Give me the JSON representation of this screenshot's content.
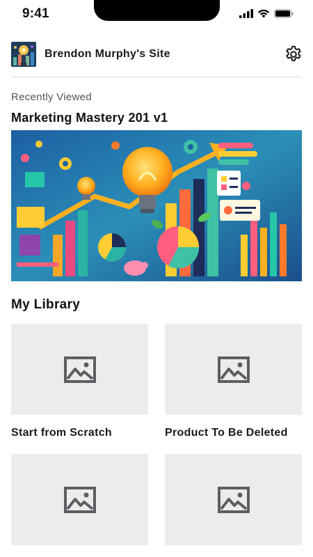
{
  "status": {
    "time": "9:41"
  },
  "header": {
    "site_title": "Brendon Murphy's Site"
  },
  "recent": {
    "label": "Recently Viewed",
    "course_title": "Marketing Mastery 201 v1"
  },
  "library": {
    "title": "My Library",
    "items": [
      {
        "label": "Start from Scratch"
      },
      {
        "label": "Product To Be Deleted"
      },
      {
        "label": ""
      },
      {
        "label": ""
      }
    ]
  },
  "icons": [
    "signal-icon",
    "wifi-icon",
    "battery-icon",
    "gear-icon",
    "image-placeholder-icon"
  ],
  "colors": {
    "placeholder_bg": "#ececed",
    "placeholder_icon": "#5c5f62",
    "divider": "#dcdcdc",
    "hero_bg": "#2a6ea8"
  }
}
